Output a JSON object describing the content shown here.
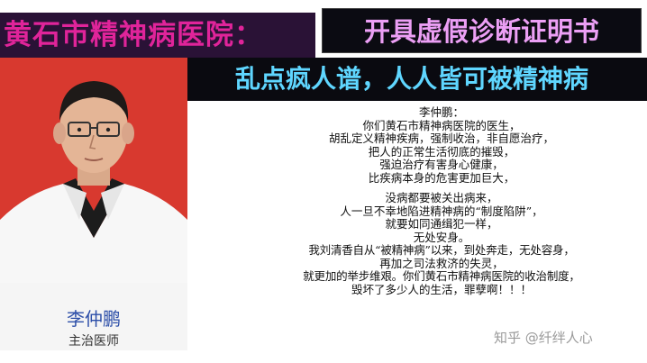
{
  "header": {
    "hospital_title": "黄石市精神病医院：",
    "headline_top": "开具虚假诊断证明书",
    "headline_bottom": "乱点疯人谱，人人皆可被精神病"
  },
  "profile": {
    "name": "李仲鹏",
    "title": "主治医师"
  },
  "text": {
    "paragraph1": [
      "李仲鹏：",
      "你们黄石市精神病医院的医生，",
      "胡乱定义精神疾病，强制收治，非自愿治疗，",
      "把人的正常生活彻底的摧毁，",
      "强迫治疗有害身心健康，",
      "比疾病本身的危害更加巨大，"
    ],
    "paragraph2": [
      "没病都要被关出病来，",
      "人一旦不幸地陷进精神病的“制度陷阱”，",
      "就要如同通缉犯一样，",
      "无处安身。",
      "我刘清香自从“被精神病”以来，到处奔走，无处容身，",
      "再加之司法救济的失灵，",
      "就更加的举步维艰。你们黄石市精神病医院的收治制度，",
      "毁坏了多少人的生活，罪孽啊！！！"
    ]
  },
  "watermark": "知乎 @纤绊人心",
  "colors": {
    "header_left_bg": "#2a1236",
    "header_left_text": "#e0249a",
    "headline_top_text": "#ec9ff5",
    "headline_bottom_text": "#5fd6ff",
    "photo_bg": "#d8392f",
    "name_text": "#2c4ea8"
  }
}
